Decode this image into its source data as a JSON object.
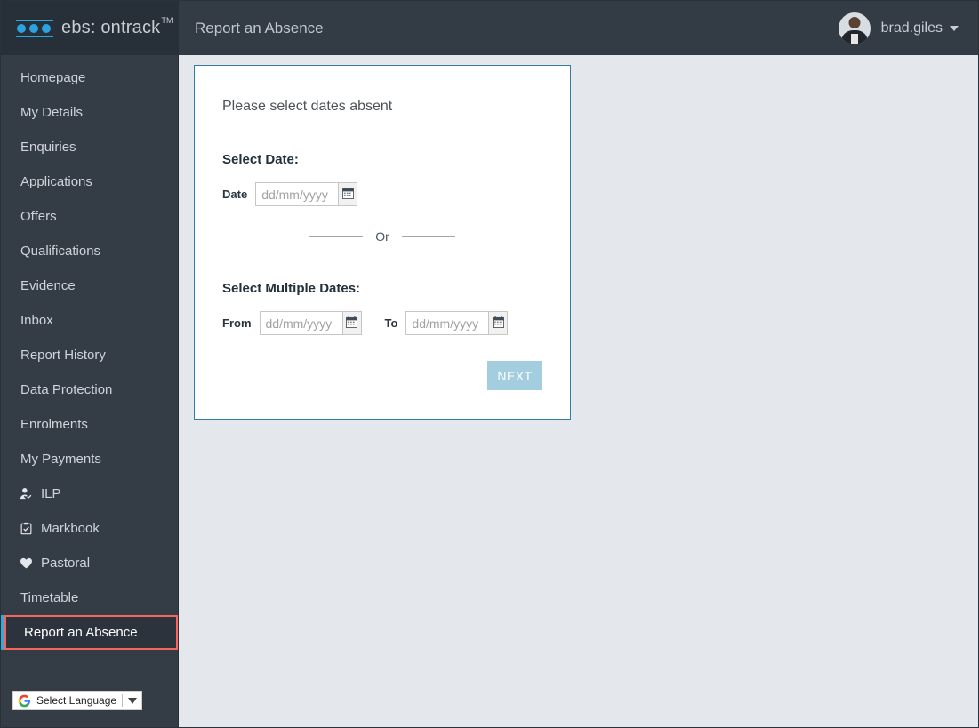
{
  "brand": {
    "name": "ebs: ontrack",
    "trademark": "TM",
    "logo_color": "#2aa3e0"
  },
  "header": {
    "title": "Report an Absence",
    "user": {
      "name": "brad.giles",
      "caret": "chevron-down-icon"
    }
  },
  "sidebar": {
    "items": [
      {
        "label": "Homepage",
        "icon": null,
        "active": false
      },
      {
        "label": "My Details",
        "icon": null,
        "active": false
      },
      {
        "label": "Enquiries",
        "icon": null,
        "active": false
      },
      {
        "label": "Applications",
        "icon": null,
        "active": false
      },
      {
        "label": "Offers",
        "icon": null,
        "active": false
      },
      {
        "label": "Qualifications",
        "icon": null,
        "active": false
      },
      {
        "label": "Evidence",
        "icon": null,
        "active": false
      },
      {
        "label": "Inbox",
        "icon": null,
        "active": false
      },
      {
        "label": "Report History",
        "icon": null,
        "active": false
      },
      {
        "label": "Data Protection",
        "icon": null,
        "active": false
      },
      {
        "label": "Enrolments",
        "icon": null,
        "active": false
      },
      {
        "label": "My Payments",
        "icon": null,
        "active": false
      },
      {
        "label": "ILP",
        "icon": "person-check-icon",
        "active": false
      },
      {
        "label": "Markbook",
        "icon": "clipboard-check-icon",
        "active": false
      },
      {
        "label": "Pastoral",
        "icon": "heart-icon",
        "active": false
      },
      {
        "label": "Timetable",
        "icon": null,
        "active": false
      },
      {
        "label": "Report an Absence",
        "icon": null,
        "active": true
      }
    ],
    "active_highlight_color": "#f8655f",
    "accent_color": "#3ba7d4",
    "background_color": "#343c46"
  },
  "language_widget": {
    "label": "Select Language",
    "icon": "google-g-icon",
    "caret": "triangle-down-icon"
  },
  "main": {
    "card": {
      "heading": "Please select dates absent",
      "border_color": "#2f7fa4",
      "single_date_section": {
        "title": "Select Date:",
        "field": {
          "label": "Date",
          "value": "",
          "placeholder": "dd/mm/yyyy",
          "calendar_icon": "calendar-icon"
        }
      },
      "divider": {
        "text": "Or"
      },
      "multiple_dates_section": {
        "title": "Select Multiple Dates:",
        "from_field": {
          "label": "From",
          "value": "",
          "placeholder": "dd/mm/yyyy",
          "calendar_icon": "calendar-icon"
        },
        "to_field": {
          "label": "To",
          "value": "",
          "placeholder": "dd/mm/yyyy",
          "calendar_icon": "calendar-icon"
        }
      },
      "next_button": {
        "label": "NEXT",
        "color": "#a4cee0"
      }
    }
  }
}
